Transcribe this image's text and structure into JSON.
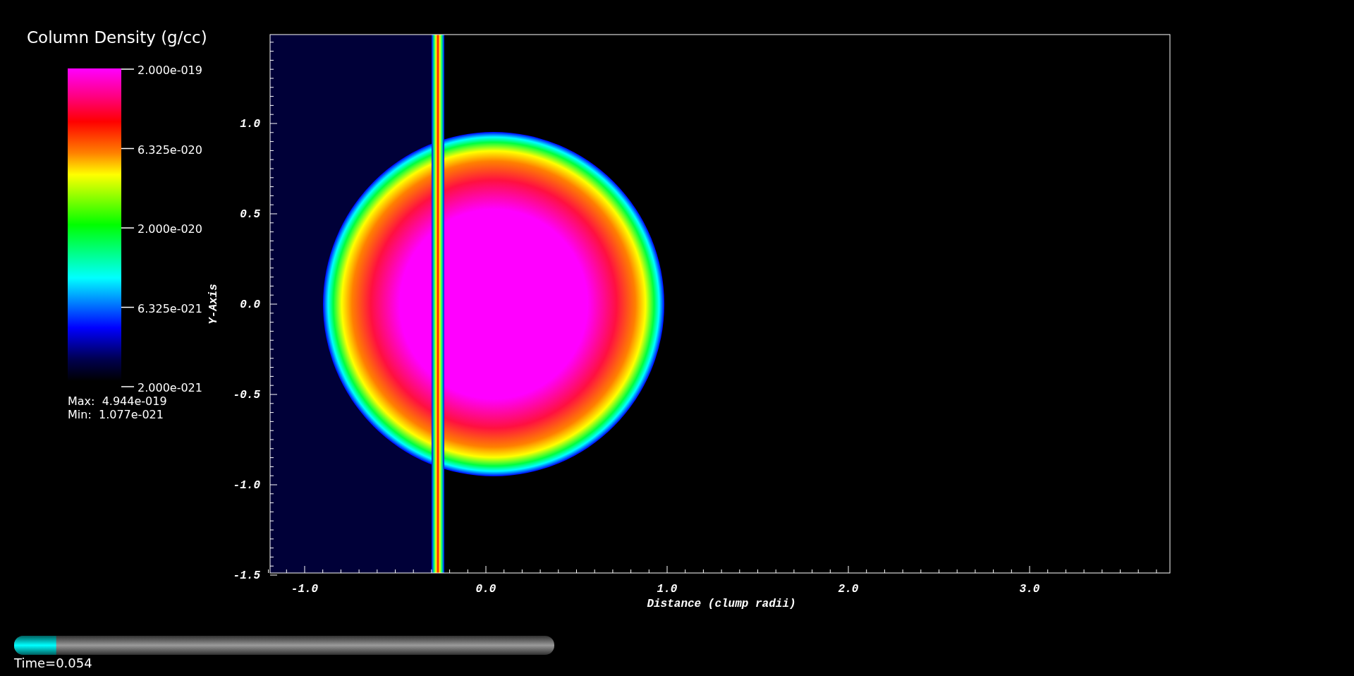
{
  "legend": {
    "title": "Column Density (g/cc)",
    "labels": [
      "2.000e-019",
      "6.325e-020",
      "2.000e-020",
      "6.325e-021",
      "2.000e-021"
    ],
    "max": "Max:  4.944e-019",
    "min": "Min:  1.077e-021"
  },
  "plot": {
    "x_ticks": [
      "-1.0",
      "0.0",
      "1.0",
      "2.0",
      "3.0"
    ],
    "y_ticks": [
      "1.0",
      "0.5",
      "0.0",
      "-0.5",
      "-1.0",
      "-1.5"
    ],
    "xlabel": "Distance (clump radii)",
    "ylabel": "Y-Axis"
  },
  "time_slider": {
    "level": 0.078,
    "label": "Time=0.054"
  }
}
